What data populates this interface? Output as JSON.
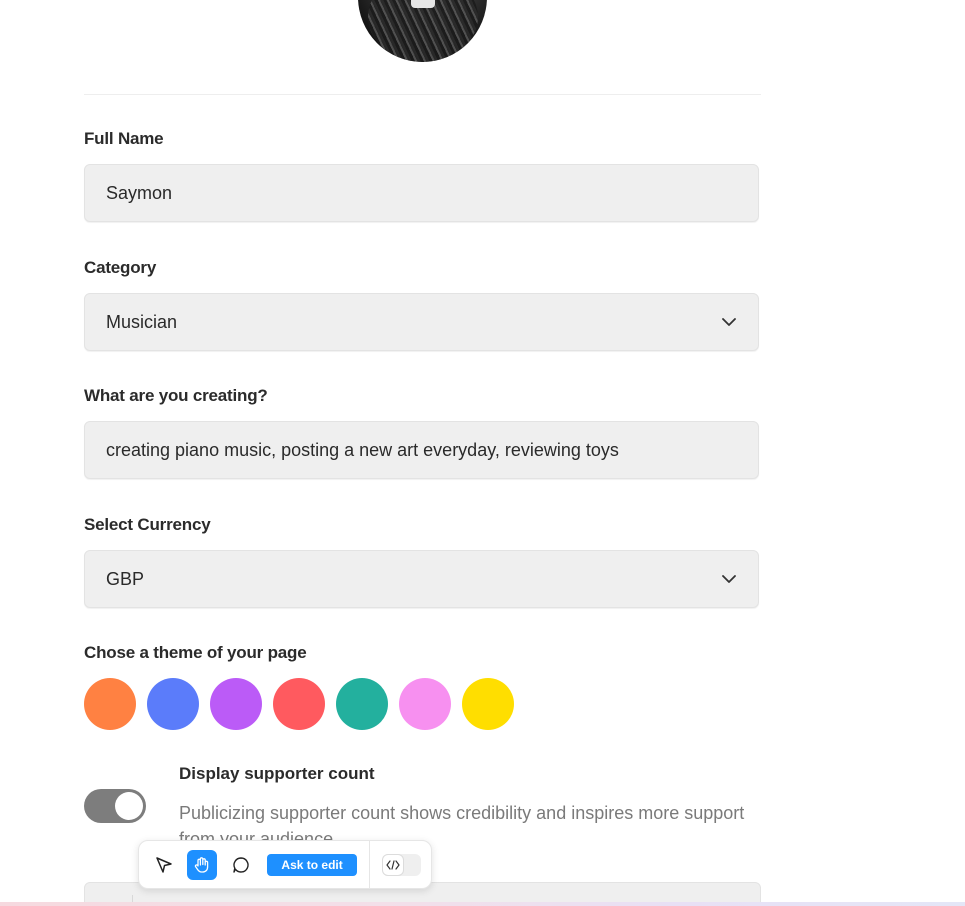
{
  "avatar": {
    "icon": "camera-icon"
  },
  "form": {
    "full_name": {
      "label": "Full Name",
      "value": "Saymon"
    },
    "category": {
      "label": "Category",
      "value": "Musician",
      "icon": "chevron-down-icon"
    },
    "creating": {
      "label": "What are you creating?",
      "value": "creating piano music, posting a new art everyday, reviewing toys"
    },
    "currency": {
      "label": "Select Currency",
      "value": "GBP",
      "icon": "chevron-down-icon"
    },
    "theme": {
      "label": "Chose a theme of your page",
      "colors": [
        "#FF8142",
        "#5B7CFA",
        "#BB5BF7",
        "#FF5A5F",
        "#23B09E",
        "#F790F0",
        "#FFDE00"
      ]
    },
    "supporter_count": {
      "title": "Display supporter count",
      "description": "Publicizing supporter count shows credibility and inspires more support from your audience.",
      "enabled": true
    }
  },
  "toolbar": {
    "ask_label": "Ask to edit",
    "tools": [
      "pointer-icon",
      "hand-icon",
      "comment-icon"
    ],
    "active_tool": "hand-icon",
    "accent": "#1E90FF"
  }
}
